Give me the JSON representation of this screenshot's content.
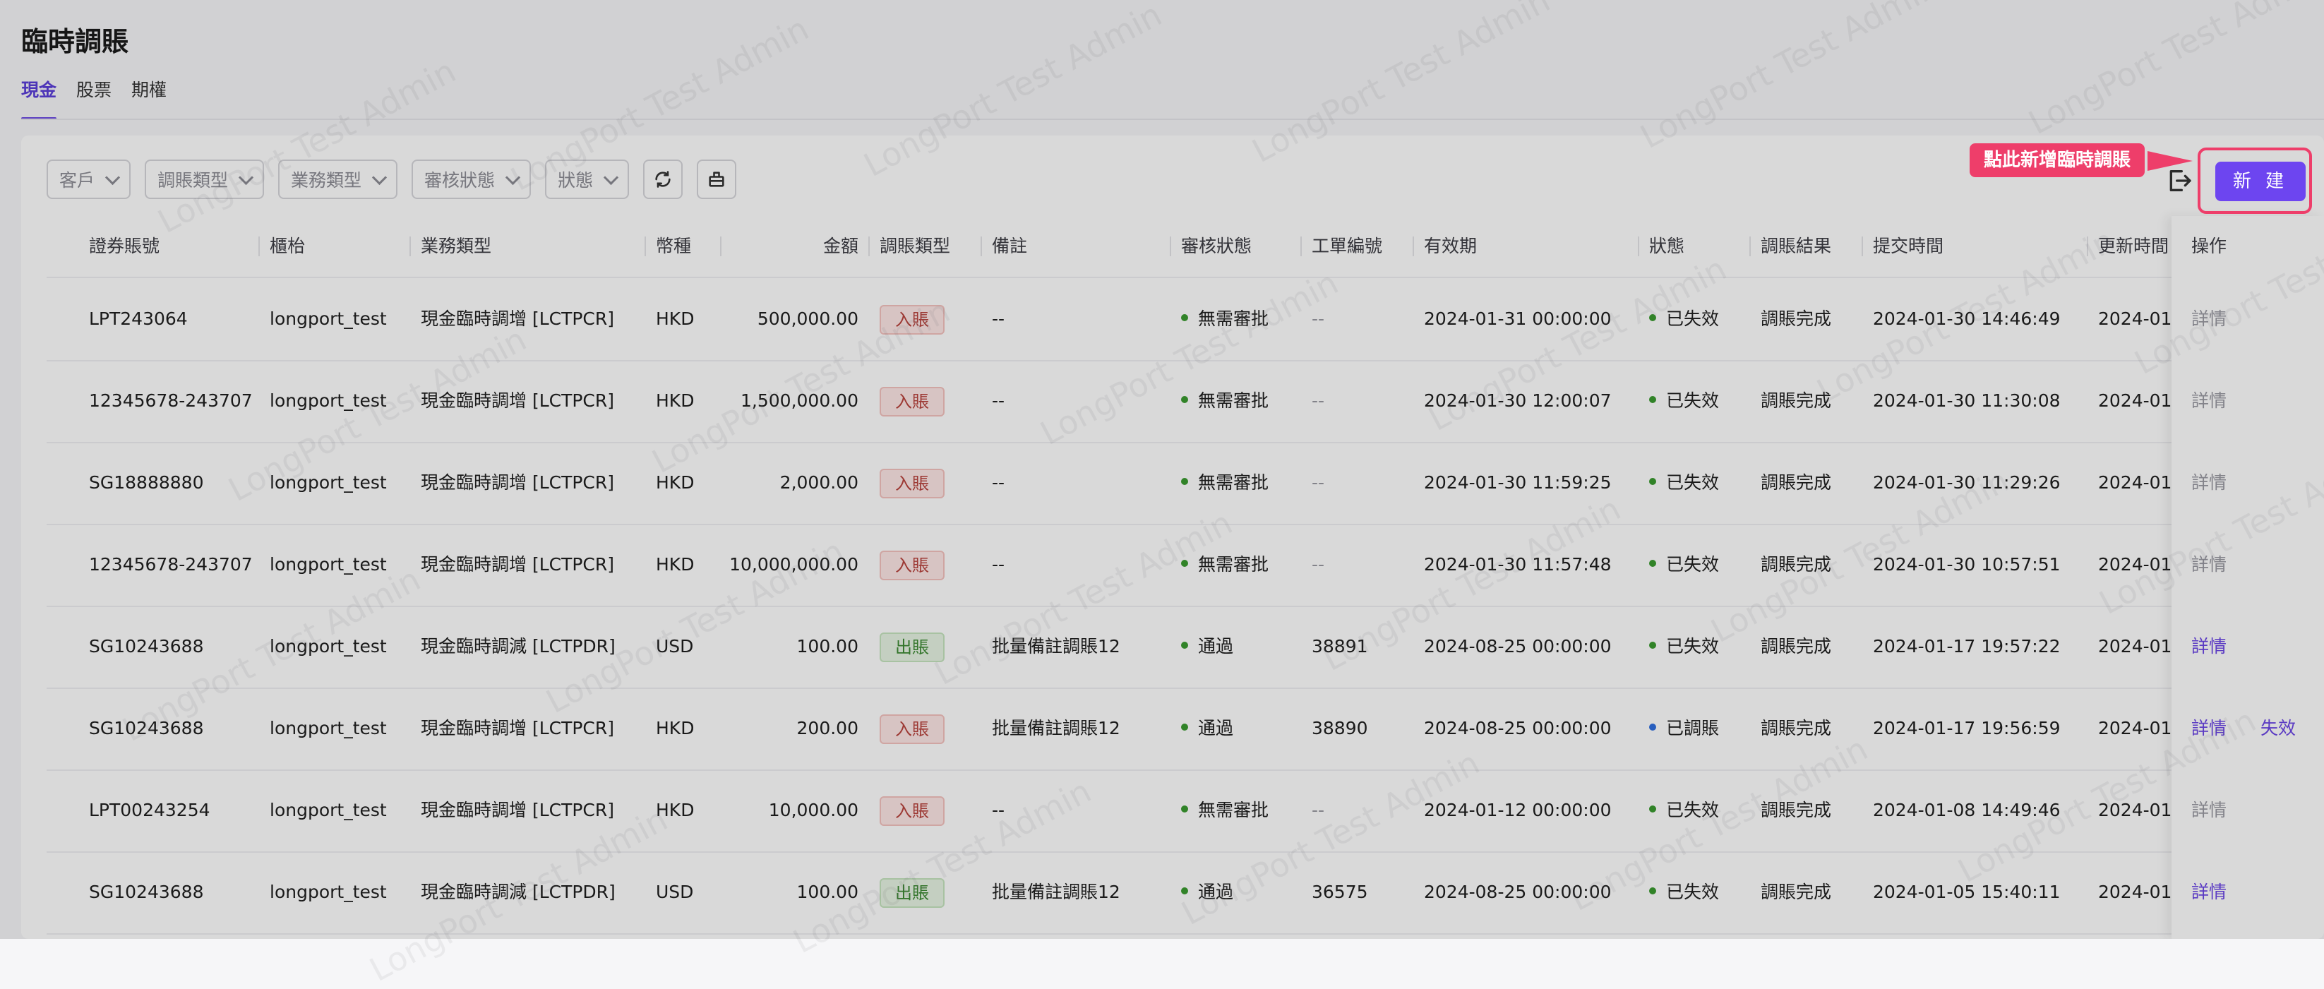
{
  "page": {
    "title": "臨時調賬",
    "tabs": [
      {
        "label": "現金",
        "active": true
      },
      {
        "label": "股票",
        "active": false
      },
      {
        "label": "期權",
        "active": false
      }
    ]
  },
  "filters": [
    "客戶",
    "調賬類型",
    "業務類型",
    "審核狀態",
    "狀態"
  ],
  "toolbar": {
    "new_button": "新 建",
    "callout": "點此新增臨時調賬"
  },
  "watermark": "LongPort Test Admin",
  "table": {
    "columns": [
      "證券賬號",
      "櫃枱",
      "業務類型",
      "幣種",
      "金額",
      "調賬類型",
      "備註",
      "審核狀態",
      "工單編號",
      "有效期",
      "狀態",
      "調賬結果",
      "提交時間",
      "更新時間",
      "操作"
    ],
    "rows": [
      {
        "account": "LPT243064",
        "counter": "longport_test",
        "biz": "現金臨時調增 [LCTPCR]",
        "ccy": "HKD",
        "amount": "500,000.00",
        "type": "入賬",
        "remark": "--",
        "audit": "無需審批",
        "ticket": "--",
        "expiry": "2024-01-31 00:00:00",
        "status": "已失效",
        "result": "調賬完成",
        "submitted": "2024-01-30 14:46:49",
        "updated": "2024-01",
        "ops": [
          "詳情"
        ]
      },
      {
        "account": "12345678-243707",
        "counter": "longport_test",
        "biz": "現金臨時調增 [LCTPCR]",
        "ccy": "HKD",
        "amount": "1,500,000.00",
        "type": "入賬",
        "remark": "--",
        "audit": "無需審批",
        "ticket": "--",
        "expiry": "2024-01-30 12:00:07",
        "status": "已失效",
        "result": "調賬完成",
        "submitted": "2024-01-30 11:30:08",
        "updated": "2024-01",
        "ops": [
          "詳情"
        ]
      },
      {
        "account": "SG18888880",
        "counter": "longport_test",
        "biz": "現金臨時調增 [LCTPCR]",
        "ccy": "HKD",
        "amount": "2,000.00",
        "type": "入賬",
        "remark": "--",
        "audit": "無需審批",
        "ticket": "--",
        "expiry": "2024-01-30 11:59:25",
        "status": "已失效",
        "result": "調賬完成",
        "submitted": "2024-01-30 11:29:26",
        "updated": "2024-01",
        "ops": [
          "詳情"
        ]
      },
      {
        "account": "12345678-243707",
        "counter": "longport_test",
        "biz": "現金臨時調增 [LCTPCR]",
        "ccy": "HKD",
        "amount": "10,000,000.00",
        "type": "入賬",
        "remark": "--",
        "audit": "無需審批",
        "ticket": "--",
        "expiry": "2024-01-30 11:57:48",
        "status": "已失效",
        "result": "調賬完成",
        "submitted": "2024-01-30 10:57:51",
        "updated": "2024-01",
        "ops": [
          "詳情"
        ]
      },
      {
        "account": "SG10243688",
        "counter": "longport_test",
        "biz": "現金臨時調減 [LCTPDR]",
        "ccy": "USD",
        "amount": "100.00",
        "type": "出賬",
        "remark": "批量備註調賬12",
        "audit": "通過",
        "ticket": "38891",
        "expiry": "2024-08-25 00:00:00",
        "status": "已失效",
        "result": "調賬完成",
        "submitted": "2024-01-17 19:57:22",
        "updated": "2024-01",
        "ops": [
          "詳情"
        ]
      },
      {
        "account": "SG10243688",
        "counter": "longport_test",
        "biz": "現金臨時調增 [LCTPCR]",
        "ccy": "HKD",
        "amount": "200.00",
        "type": "入賬",
        "remark": "批量備註調賬12",
        "audit": "通過",
        "ticket": "38890",
        "expiry": "2024-08-25 00:00:00",
        "status": "已調賬",
        "result": "調賬完成",
        "submitted": "2024-01-17 19:56:59",
        "updated": "2024-01",
        "ops": [
          "詳情",
          "失效"
        ]
      },
      {
        "account": "LPT00243254",
        "counter": "longport_test",
        "biz": "現金臨時調增 [LCTPCR]",
        "ccy": "HKD",
        "amount": "10,000.00",
        "type": "入賬",
        "remark": "--",
        "audit": "無需審批",
        "ticket": "--",
        "expiry": "2024-01-12 00:00:00",
        "status": "已失效",
        "result": "調賬完成",
        "submitted": "2024-01-08 14:49:46",
        "updated": "2024-01",
        "ops": [
          "詳情"
        ]
      },
      {
        "account": "SG10243688",
        "counter": "longport_test",
        "biz": "現金臨時調減 [LCTPDR]",
        "ccy": "USD",
        "amount": "100.00",
        "type": "出賬",
        "remark": "批量備註調賬12",
        "audit": "通過",
        "ticket": "36575",
        "expiry": "2024-08-25 00:00:00",
        "status": "已失效",
        "result": "調賬完成",
        "submitted": "2024-01-05 15:40:11",
        "updated": "2024-01",
        "ops": [
          "詳情"
        ]
      }
    ]
  },
  "colors": {
    "accent": "#6d45f0",
    "callout": "#ee3e6a",
    "status_green": "#3a9a2f",
    "status_blue": "#2f6fe0"
  }
}
